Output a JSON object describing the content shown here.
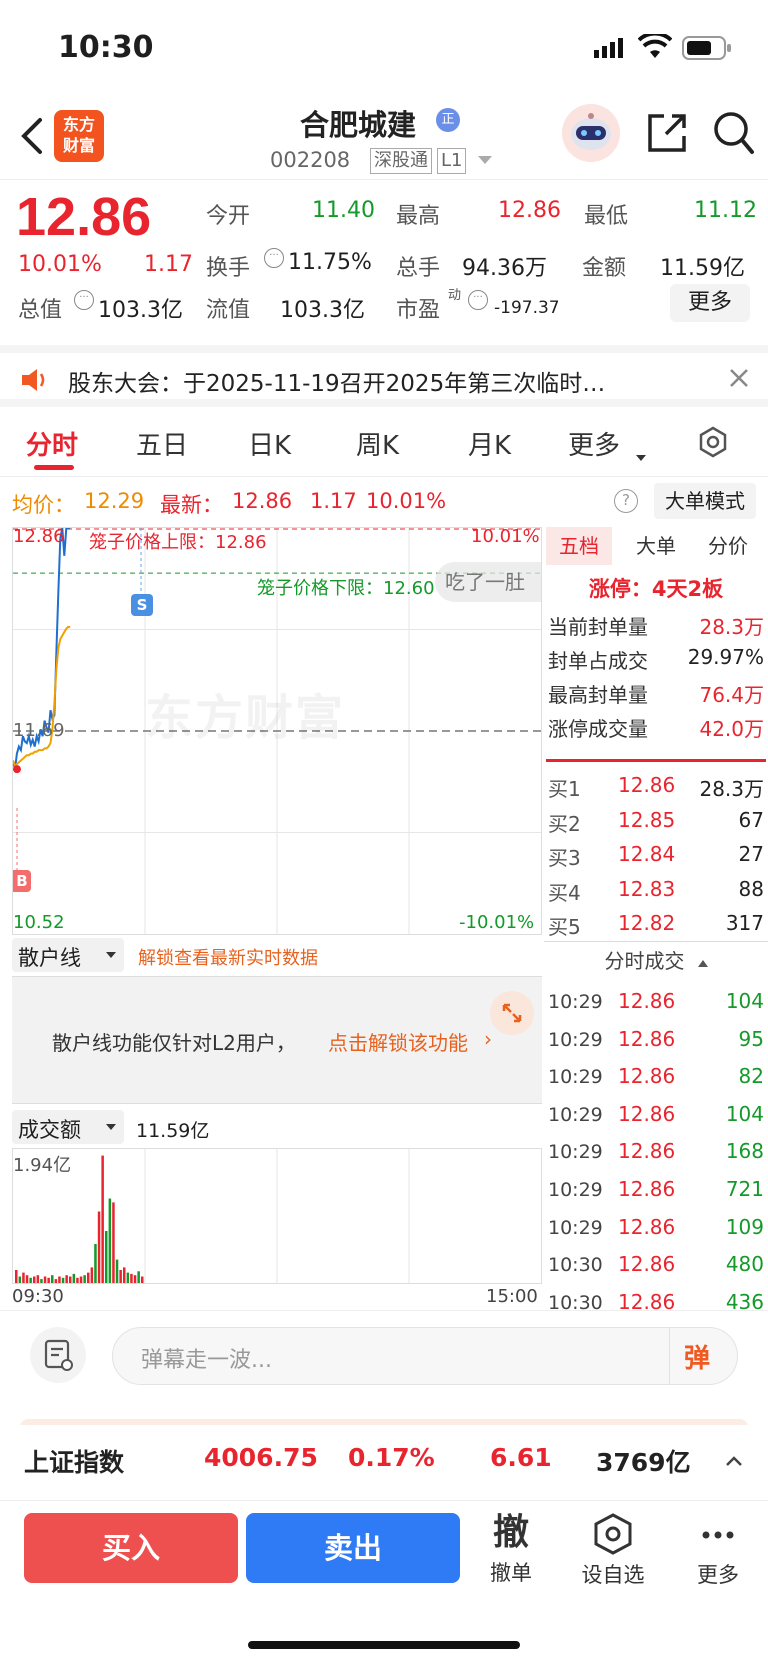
{
  "status": {
    "time": "10:30"
  },
  "header": {
    "logo_text": "东方\n财富",
    "stock_name": "合肥城建",
    "stock_code": "002208",
    "market_tag": "深股通",
    "level_tag": "L1"
  },
  "quote": {
    "price": "12.86",
    "change_pct": "10.01%",
    "change_amt": "1.17",
    "labels": {
      "open": "今开",
      "high": "最高",
      "low": "最低",
      "turnover": "换手",
      "volume": "总手",
      "amount": "金额",
      "mktcap": "总值",
      "float": "流值",
      "pe": "市盈",
      "pe_sup": "动"
    },
    "open": "11.40",
    "high": "12.86",
    "low": "11.12",
    "turnover": "11.75%",
    "volume": "94.36万",
    "amount": "11.59亿",
    "mktcap": "103.3亿",
    "float": "103.3亿",
    "pe": "-197.37",
    "more": "更多"
  },
  "notice": {
    "text": "股东大会：于2025-11-19召开2025年第三次临时…"
  },
  "tabs": [
    "分时",
    "五日",
    "日K",
    "周K",
    "月K",
    "更多"
  ],
  "info": {
    "avg_label": "均价：",
    "avg": "12.29",
    "latest_label": "最新：",
    "latest": "12.86",
    "chg": "1.17",
    "pct": "10.01%",
    "mode_btn": "大单模式"
  },
  "chart": {
    "top_price": "12.86",
    "top_pct": "10.01%",
    "mid_price": "11.69",
    "bottom_price": "10.52",
    "bottom_pct": "-10.01%",
    "upper_limit_text": "笼子价格上限：12.86",
    "lower_limit_text": "笼子价格下限：12.60",
    "bubble": "吃了一肚",
    "watermark": "东方财富",
    "marker_s": "S",
    "marker_b": "B"
  },
  "chart_data": {
    "type": "line",
    "title": "",
    "ylim": [
      10.52,
      12.86
    ],
    "x_start": "09:30",
    "x_end": "15:00",
    "series": [
      {
        "name": "",
        "color": "#1f6fd1",
        "values": [
          11.52,
          11.47,
          11.56,
          11.6,
          11.58,
          11.66,
          11.63,
          11.62,
          11.66,
          11.61,
          11.64,
          11.6,
          11.66,
          11.63,
          11.7,
          11.66,
          11.75,
          11.71,
          11.68,
          11.81,
          11.76,
          11.78,
          12.15,
          12.5,
          12.8,
          12.86,
          12.7,
          12.86,
          12.86,
          12.86
        ]
      },
      {
        "name": "",
        "color": "#f0a000",
        "values": [
          11.52,
          11.49,
          11.5,
          11.51,
          11.52,
          11.53,
          11.54,
          11.55,
          11.55,
          11.56,
          11.56,
          11.57,
          11.57,
          11.58,
          11.58,
          11.58,
          11.59,
          11.59,
          11.6,
          11.62,
          11.7,
          11.85,
          12.05,
          12.17,
          12.22,
          12.24,
          12.26,
          12.28,
          12.29,
          12.29
        ]
      }
    ],
    "lines": {
      "upper_limit": 12.86,
      "lower_limit": 12.6,
      "prev_close": 11.69
    }
  },
  "retail": {
    "dropdown": "散户线",
    "unlock_text": "解锁查看最新实时数据",
    "msg": "散户线功能仅针对L2用户，",
    "msg_link": "点击解锁该功能"
  },
  "volume": {
    "dropdown": "成交额",
    "total": "11.59亿",
    "max": "1.94亿",
    "time_start": "09:30",
    "time_end": "15:00",
    "bars": [
      0.1,
      0.05,
      0.08,
      0.06,
      0.04,
      0.05,
      0.06,
      0.03,
      0.05,
      0.04,
      0.06,
      0.03,
      0.05,
      0.04,
      0.06,
      0.05,
      0.07,
      0.04,
      0.05,
      0.06,
      0.08,
      0.12,
      0.3,
      0.55,
      0.98,
      0.4,
      0.65,
      0.62,
      0.18,
      0.1,
      0.12,
      0.08,
      0.07,
      0.06,
      0.09,
      0.05
    ]
  },
  "rightpanel": {
    "tabs": [
      "五档",
      "大单",
      "分价"
    ],
    "limit_title": "涨停：4天2板",
    "stats": [
      {
        "label": "当前封单量",
        "value": "28.3万"
      },
      {
        "label": "封单占成交",
        "value": "29.97%"
      },
      {
        "label": "最高封单量",
        "value": "76.4万"
      },
      {
        "label": "涨停成交量",
        "value": "42.0万"
      }
    ],
    "bids": [
      {
        "label": "买1",
        "price": "12.86",
        "vol": "28.3万"
      },
      {
        "label": "买2",
        "price": "12.85",
        "vol": "67"
      },
      {
        "label": "买3",
        "price": "12.84",
        "vol": "27"
      },
      {
        "label": "买4",
        "price": "12.83",
        "vol": "88"
      },
      {
        "label": "买5",
        "price": "12.82",
        "vol": "317"
      }
    ],
    "ticks_title": "分时成交",
    "ticks": [
      {
        "t": "10:29",
        "p": "12.86",
        "v": "104"
      },
      {
        "t": "10:29",
        "p": "12.86",
        "v": "95"
      },
      {
        "t": "10:29",
        "p": "12.86",
        "v": "82"
      },
      {
        "t": "10:29",
        "p": "12.86",
        "v": "104"
      },
      {
        "t": "10:29",
        "p": "12.86",
        "v": "168"
      },
      {
        "t": "10:29",
        "p": "12.86",
        "v": "721"
      },
      {
        "t": "10:29",
        "p": "12.86",
        "v": "109"
      },
      {
        "t": "10:30",
        "p": "12.86",
        "v": "480"
      },
      {
        "t": "10:30",
        "p": "12.86",
        "v": "436"
      }
    ]
  },
  "danmu": {
    "placeholder": "弹幕走一波...",
    "send": "弹"
  },
  "index": {
    "name": "上证指数",
    "value": "4006.75",
    "pct": "0.17%",
    "chg": "6.61",
    "amount": "3769亿"
  },
  "bottom": {
    "buy": "买入",
    "sell": "卖出",
    "cancel_glyph": "撤",
    "cancel": "撤单",
    "watch": "设自选",
    "more": "更多"
  },
  "colors": {
    "red": "#e8252f",
    "green": "#14992a",
    "blue": "#2f7bf5",
    "orange": "#f08a00"
  }
}
